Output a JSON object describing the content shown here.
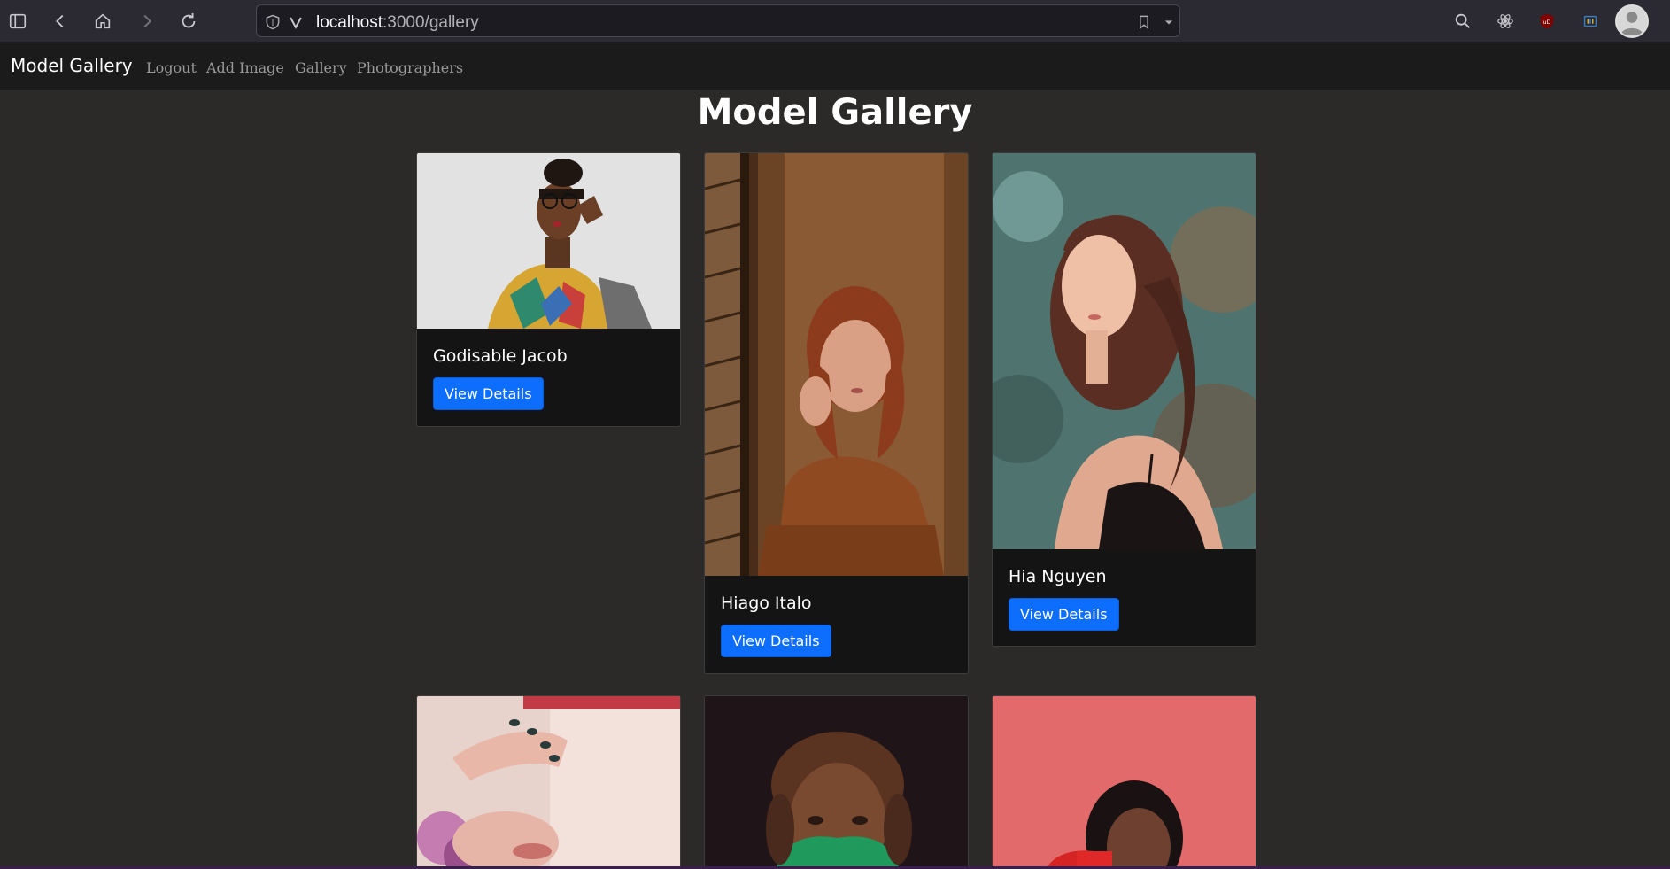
{
  "browser": {
    "url_host": "localhost",
    "url_path": ":3000/gallery"
  },
  "navbar": {
    "brand": "Model Gallery",
    "links": [
      "Logout",
      "Add Image",
      "Gallery",
      "Photographers"
    ]
  },
  "page": {
    "title": "Model Gallery"
  },
  "cards": [
    {
      "name": "Godisable Jacob",
      "button": "View Details"
    },
    {
      "name": "Hiago Italo",
      "button": "View Details"
    },
    {
      "name": "Hia Nguyen",
      "button": "View Details"
    }
  ],
  "colors": {
    "accent": "#0d6efd",
    "page_bg": "#2b2a28",
    "navbar_bg": "#1b1b1b"
  }
}
